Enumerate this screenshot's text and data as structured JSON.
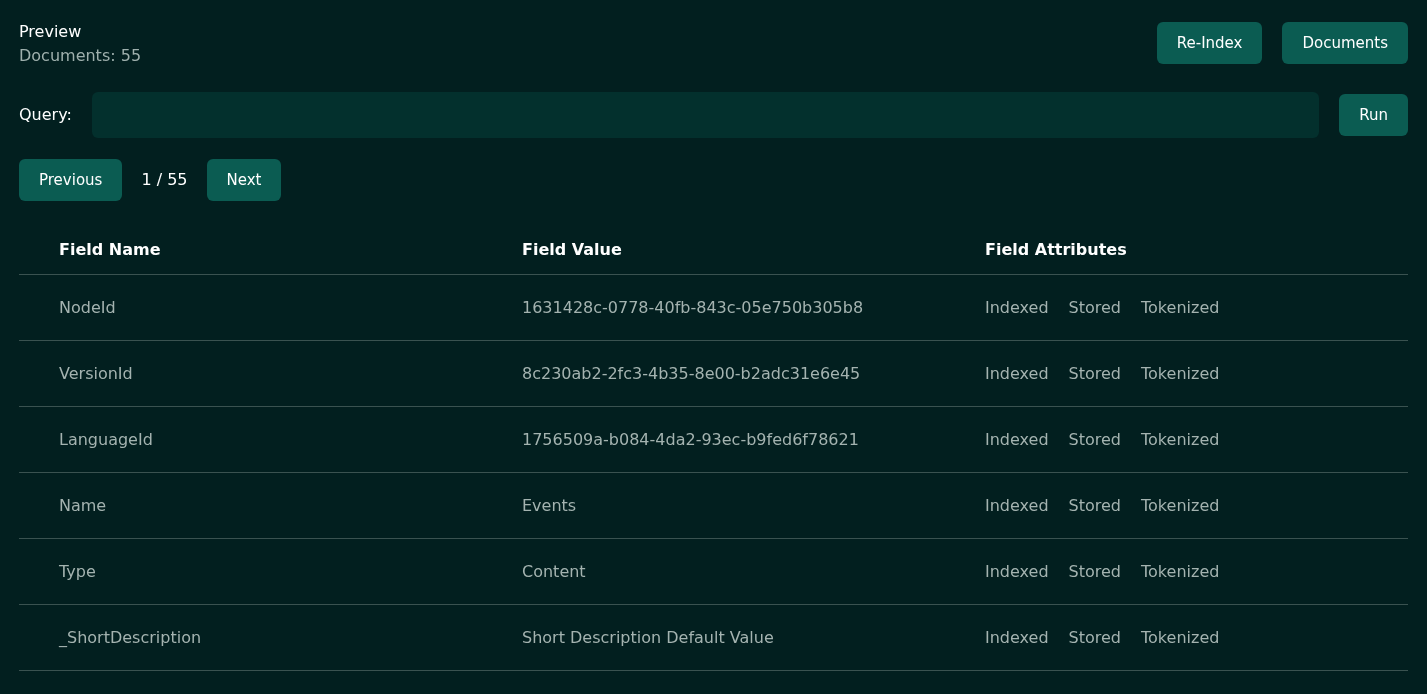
{
  "header": {
    "title": "Preview",
    "subtitle": "Documents: 55"
  },
  "actions": [
    "Re-Index",
    "Documents"
  ],
  "query": {
    "label": "Query:",
    "button": "Run"
  },
  "pagination": {
    "previous": "Previous",
    "page": "1 / 55",
    "next": "Next"
  },
  "table": {
    "columns": [
      "Field Name",
      "Field Value",
      "Field Attributes"
    ],
    "rows": [
      {
        "name": "NodeId",
        "value": "1631428c-0778-40fb-843c-05e750b305b8",
        "attributes": [
          "Indexed",
          "Stored",
          "Tokenized"
        ]
      },
      {
        "name": "VersionId",
        "value": "8c230ab2-2fc3-4b35-8e00-b2adc31e6e45",
        "attributes": [
          "Indexed",
          "Stored",
          "Tokenized"
        ]
      },
      {
        "name": "LanguageId",
        "value": "1756509a-b084-4da2-93ec-b9fed6f78621",
        "attributes": [
          "Indexed",
          "Stored",
          "Tokenized"
        ]
      },
      {
        "name": "Name",
        "value": "Events",
        "attributes": [
          "Indexed",
          "Stored",
          "Tokenized"
        ]
      },
      {
        "name": "Type",
        "value": "Content",
        "attributes": [
          "Indexed",
          "Stored",
          "Tokenized"
        ]
      },
      {
        "name": "_ShortDescription",
        "value": "Short Description Default Value",
        "attributes": [
          "Indexed",
          "Stored",
          "Tokenized"
        ]
      }
    ]
  }
}
